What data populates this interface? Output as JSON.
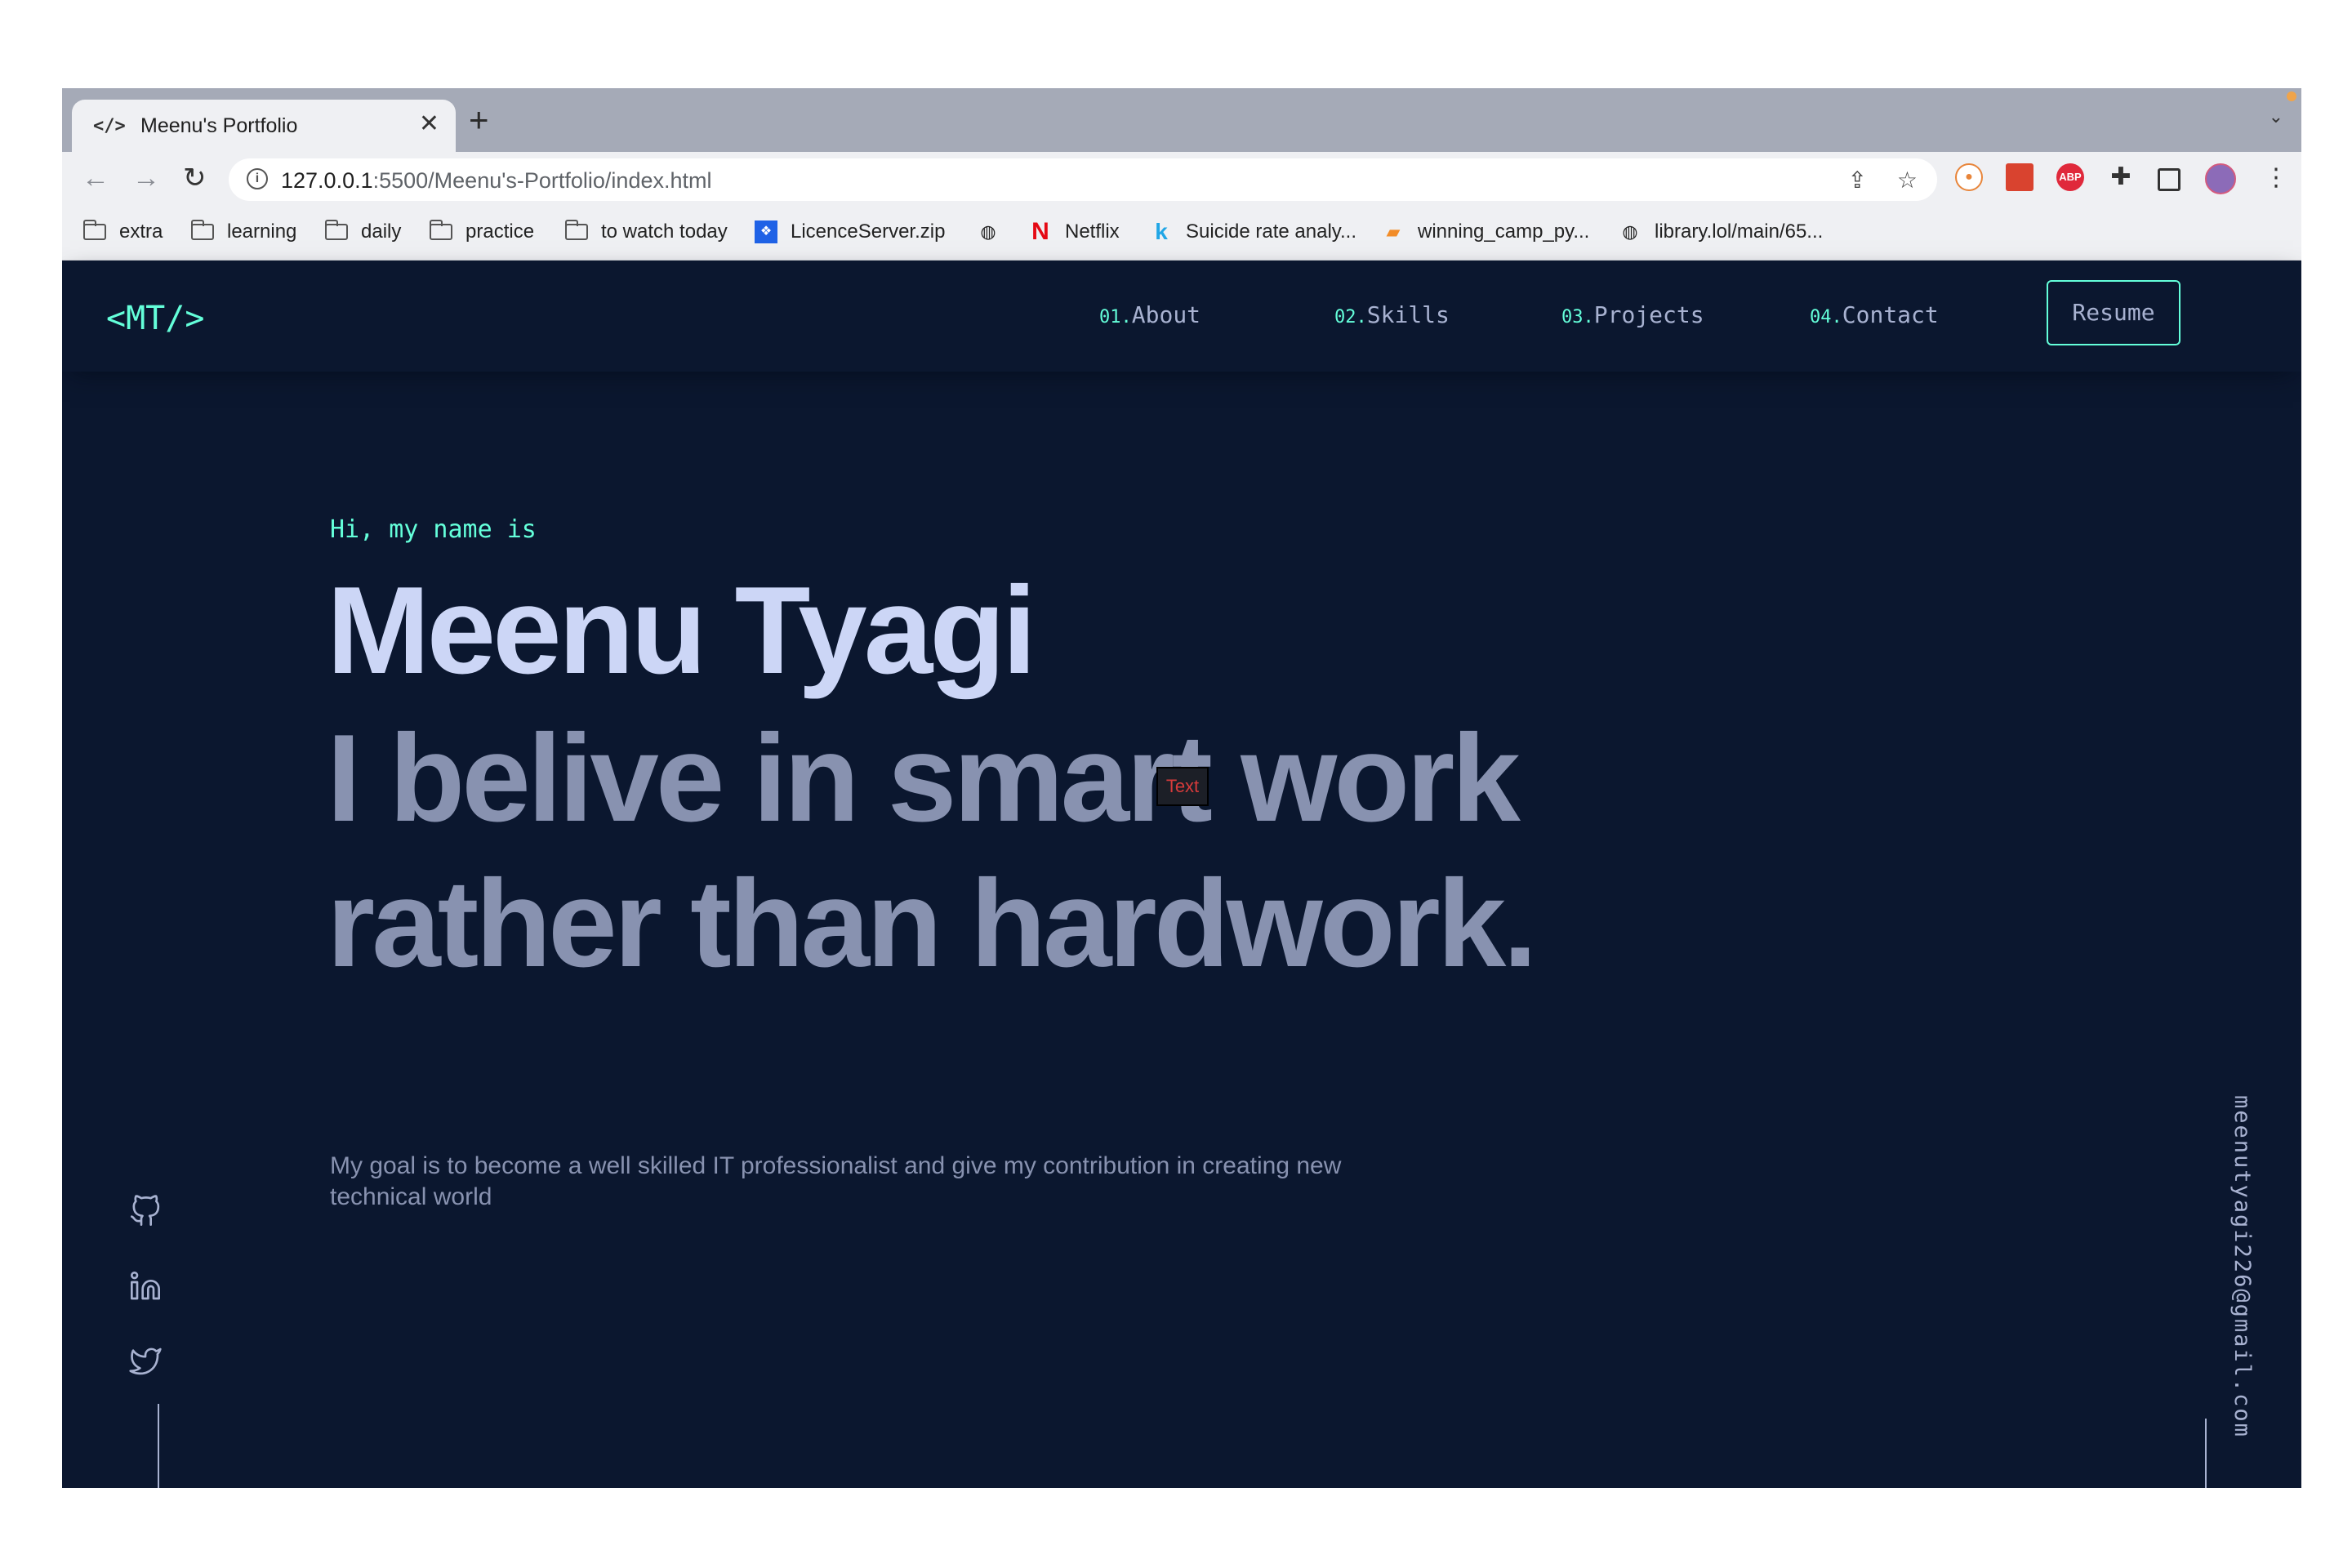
{
  "browser": {
    "tab": {
      "icon": "code-icon",
      "title": "Meenu's Portfolio"
    },
    "new_tab": "+",
    "url": {
      "host": "127.0.0.1",
      "rest": ":5500/Meenu's-Portfolio/index.html"
    },
    "bookmarks": [
      {
        "label": "extra",
        "icon": "folder-icon"
      },
      {
        "label": "learning",
        "icon": "folder-icon"
      },
      {
        "label": "daily",
        "icon": "folder-icon"
      },
      {
        "label": "practice",
        "icon": "folder-icon"
      },
      {
        "label": "to watch today",
        "icon": "folder-icon"
      },
      {
        "label": "LicenceServer.zip",
        "icon": "dropbox-icon"
      },
      {
        "label": "",
        "icon": "globe-icon"
      },
      {
        "label": "Netflix",
        "icon": "netflix-icon"
      },
      {
        "label": "Suicide rate analy...",
        "icon": "kaggle-icon"
      },
      {
        "label": "winning_camp_py...",
        "icon": "notebook-icon"
      },
      {
        "label": "library.lol/main/65...",
        "icon": "globe-icon"
      }
    ]
  },
  "site": {
    "logo": "<MT/>",
    "nav": [
      {
        "num": "01.",
        "label": "About"
      },
      {
        "num": "02.",
        "label": "Skills"
      },
      {
        "num": "03.",
        "label": "Projects"
      },
      {
        "num": "04.",
        "label": "Contact"
      }
    ],
    "resume": "Resume",
    "hero": {
      "greeting": "Hi, my name is",
      "name": "Meenu Tyagi",
      "tagline_1": "I belive in smart work",
      "tagline_2": "rather than hardwork.",
      "marker": "Text",
      "goal": "My goal is to become a well skilled IT professionalist and give my contribution in creating new technical world"
    },
    "social": [
      "github-icon",
      "linkedin-icon",
      "twitter-icon"
    ],
    "email": "meenutyagi226@gmail.com"
  },
  "colors": {
    "bg": "#0b172f",
    "accent": "#64ffda",
    "heading": "#ccd6f6",
    "muted": "#8892b0"
  }
}
